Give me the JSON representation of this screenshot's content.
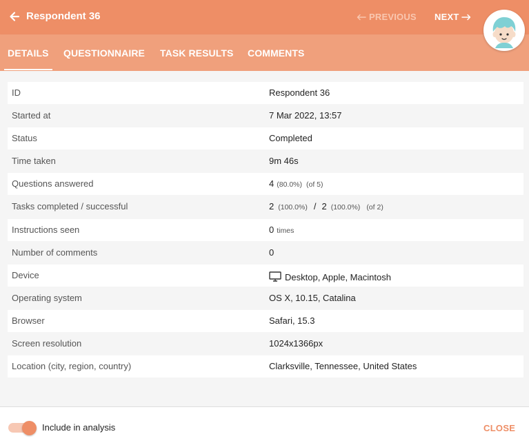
{
  "header": {
    "title": "Respondent 36",
    "previous_label": "PREVIOUS",
    "next_label": "NEXT",
    "back_icon": "arrow-left-icon",
    "colors": {
      "accent": "#ee8e66",
      "tab_bar": "#f0a07c",
      "disabled_text": "#f9c7b0"
    }
  },
  "tabs": [
    {
      "label": "DETAILS",
      "active": true
    },
    {
      "label": "QUESTIONNAIRE",
      "active": false
    },
    {
      "label": "TASK RESULTS",
      "active": false
    },
    {
      "label": "COMMENTS",
      "active": false
    }
  ],
  "details": {
    "id": {
      "label": "ID",
      "value": "Respondent 36"
    },
    "started_at": {
      "label": "Started at",
      "value": "7 Mar 2022, 13:57"
    },
    "status": {
      "label": "Status",
      "value": "Completed"
    },
    "time_taken": {
      "label": "Time taken",
      "value": "9m 46s"
    },
    "questions_answered": {
      "label": "Questions answered",
      "count": "4",
      "percent": "(80.0%)",
      "of": "(of 5)"
    },
    "tasks": {
      "label": "Tasks completed / successful",
      "completed": "2",
      "completed_percent": "(100.0%)",
      "separator": "/",
      "successful": "2",
      "successful_percent": "(100.0%)",
      "of": "(of 2)"
    },
    "instructions_seen": {
      "label": "Instructions seen",
      "count": "0",
      "unit": "times"
    },
    "comments": {
      "label": "Number of comments",
      "value": "0"
    },
    "device": {
      "label": "Device",
      "icon": "desktop-monitor-icon",
      "value": "Desktop, Apple, Macintosh"
    },
    "os": {
      "label": "Operating system",
      "value": "OS X, 10.15, Catalina"
    },
    "browser": {
      "label": "Browser",
      "value": "Safari, 15.3"
    },
    "resolution": {
      "label": "Screen resolution",
      "value": "1024x1366px"
    },
    "location": {
      "label": "Location (city, region, country)",
      "value": "Clarksville, Tennessee, United States"
    }
  },
  "footer": {
    "toggle_label": "Include in analysis",
    "toggle_on": true,
    "close_label": "CLOSE"
  }
}
